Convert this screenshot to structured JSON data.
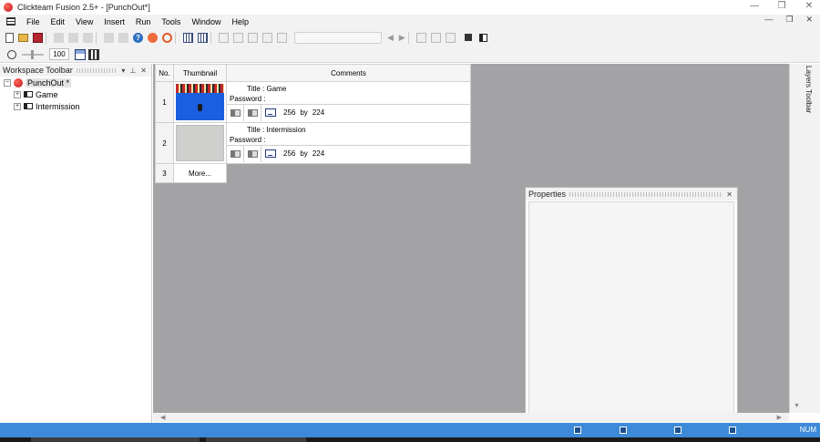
{
  "window": {
    "title": "Clickteam Fusion 2.5+ - [PunchOut*]"
  },
  "menu": {
    "items": [
      "File",
      "Edit",
      "View",
      "Insert",
      "Run",
      "Tools",
      "Window",
      "Help"
    ]
  },
  "toolbar": {
    "zoom_value": "100"
  },
  "workspace": {
    "title": "Workspace Toolbar",
    "root_label": "PunchOut *",
    "items": [
      {
        "label": "Game"
      },
      {
        "label": "Intermission"
      }
    ]
  },
  "storyboard": {
    "headers": {
      "no": "No.",
      "thumbnail": "Thumbnail",
      "comments": "Comments"
    },
    "frames": [
      {
        "no": "1",
        "title": "Title : Game",
        "password": "Password :",
        "width": "256",
        "by": "by",
        "height": "224"
      },
      {
        "no": "2",
        "title": "Title : Intermission",
        "password": "Password :",
        "width": "256",
        "by": "by",
        "height": "224"
      }
    ],
    "more_row": {
      "no": "3",
      "label": "More..."
    }
  },
  "properties": {
    "title": "Properties"
  },
  "layers": {
    "label": "Layers Toolbar"
  },
  "status": {
    "num": "NUM"
  },
  "colors": {
    "statusbar": "#3c8ad8",
    "editor_background": "#a3a3a5",
    "accent": "#c0141a"
  },
  "icons": {
    "app": "clickteam-logo-icon",
    "frame": "frame-icon"
  }
}
